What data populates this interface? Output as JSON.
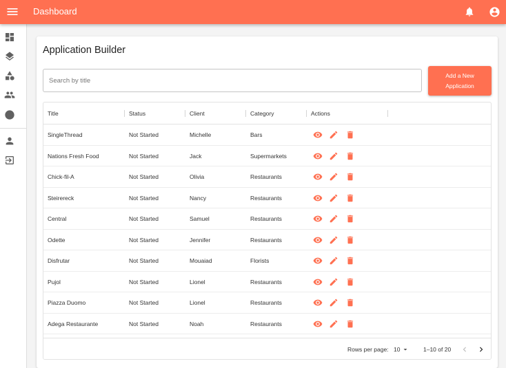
{
  "app": {
    "title": "Dashboard"
  },
  "colors": {
    "accent": "#ff7051",
    "icon_gray": "#616161"
  },
  "topbar": {
    "icons": [
      "menu-icon",
      "notifications-icon",
      "account-circle-icon"
    ]
  },
  "sidebar": {
    "items": [
      {
        "icon": "dashboard-icon"
      },
      {
        "icon": "layers-icon"
      },
      {
        "icon": "category-shapes-icon"
      },
      {
        "icon": "people-icon"
      },
      {
        "icon": "help-icon"
      },
      {
        "icon": "person-icon"
      },
      {
        "icon": "logout-icon"
      }
    ]
  },
  "page": {
    "title": "Application Builder",
    "search_placeholder": "Search by title",
    "add_button_line1": "Add a New",
    "add_button_line2": "Application"
  },
  "table": {
    "columns": [
      "Title",
      "Status",
      "Client",
      "Category",
      "Actions"
    ],
    "rows": [
      [
        "SingleThread",
        "Not Started",
        "Michelle",
        "Bars"
      ],
      [
        "Nations Fresh Food",
        "Not Started",
        "Jack",
        "Supermarkets"
      ],
      [
        "Chick-fil-A",
        "Not Started",
        "Olivia",
        "Restaurants"
      ],
      [
        "Steirereck",
        "Not Started",
        "Nancy",
        "Restaurants"
      ],
      [
        "Central",
        "Not Started",
        "Samuel",
        "Restaurants"
      ],
      [
        "Odette",
        "Not Started",
        "Jennifer",
        "Restaurants"
      ],
      [
        "Disfrutar",
        "Not Started",
        "Mouaiad",
        "Florists"
      ],
      [
        "Pujol",
        "Not Started",
        "Lionel",
        "Restaurants"
      ],
      [
        "Piazza Duomo",
        "Not Started",
        "Lionel",
        "Restaurants"
      ],
      [
        "Adega Restaurante",
        "Not Started",
        "Noah",
        "Restaurants"
      ]
    ],
    "row_actions": [
      "view-icon",
      "edit-icon",
      "delete-icon"
    ]
  },
  "pagination": {
    "rows_per_page_label": "Rows per page:",
    "rows_per_page_value": "10",
    "range_text": "1–10 of 20"
  }
}
